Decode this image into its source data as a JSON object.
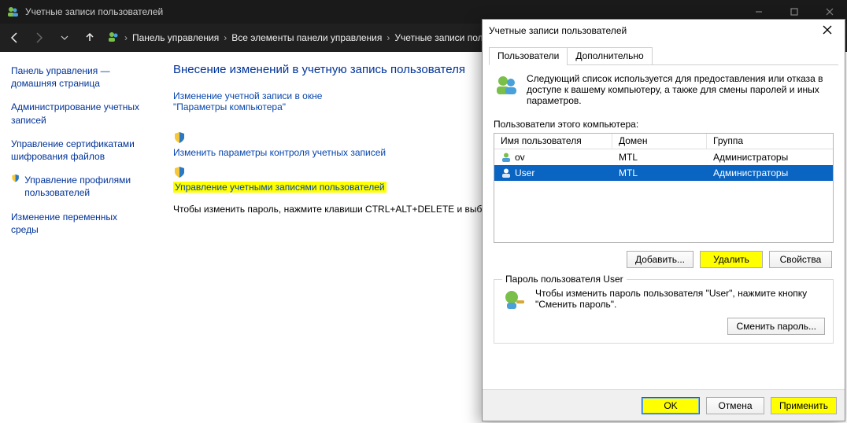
{
  "window": {
    "title": "Учетные записи пользователей"
  },
  "breadcrumb": {
    "items": [
      "Панель управления",
      "Все элементы панели управления",
      "Учетные записи поль..."
    ]
  },
  "sidebar": {
    "home": "Панель управления — домашняя страница",
    "items": [
      "Администрирование учетных записей",
      "Управление сертификатами шифрования файлов",
      "Управление профилями пользователей",
      "Изменение переменных среды"
    ]
  },
  "main": {
    "heading": "Внесение изменений в учетную запись пользователя",
    "link1": "Изменение учетной записи в окне \"Параметры компьютера\"",
    "link2": "Изменить параметры контроля учетных записей",
    "link3": "Управление учетными записями пользователей",
    "hint": "Чтобы изменить пароль, нажмите клавиши CTRL+ALT+DELETE и выбе"
  },
  "dialog": {
    "title": "Учетные записи пользователей",
    "tabs": {
      "users": "Пользователи",
      "advanced": "Дополнительно"
    },
    "intro": "Следующий список используется для предоставления или отказа в доступе к вашему компьютеру, а также для смены паролей и иных параметров.",
    "list_label": "Пользователи этого компьютера:",
    "columns": {
      "c1": "Имя пользователя",
      "c2": "Домен",
      "c3": "Группа"
    },
    "rows": [
      {
        "user": "     ov",
        "domain": "MTL",
        "group": "Администраторы",
        "selected": false
      },
      {
        "user": "User",
        "domain": "MTL     ",
        "group": "Администраторы",
        "selected": true
      }
    ],
    "buttons": {
      "add": "Добавить...",
      "remove": "Удалить",
      "props": "Свойства"
    },
    "pw_group": {
      "legend": "Пароль пользователя User",
      "text": "Чтобы изменить пароль пользователя \"User\", нажмите кнопку \"Сменить пароль\".",
      "btn": "Сменить пароль..."
    },
    "footer": {
      "ok": "OK",
      "cancel": "Отмена",
      "apply": "Применить"
    }
  }
}
